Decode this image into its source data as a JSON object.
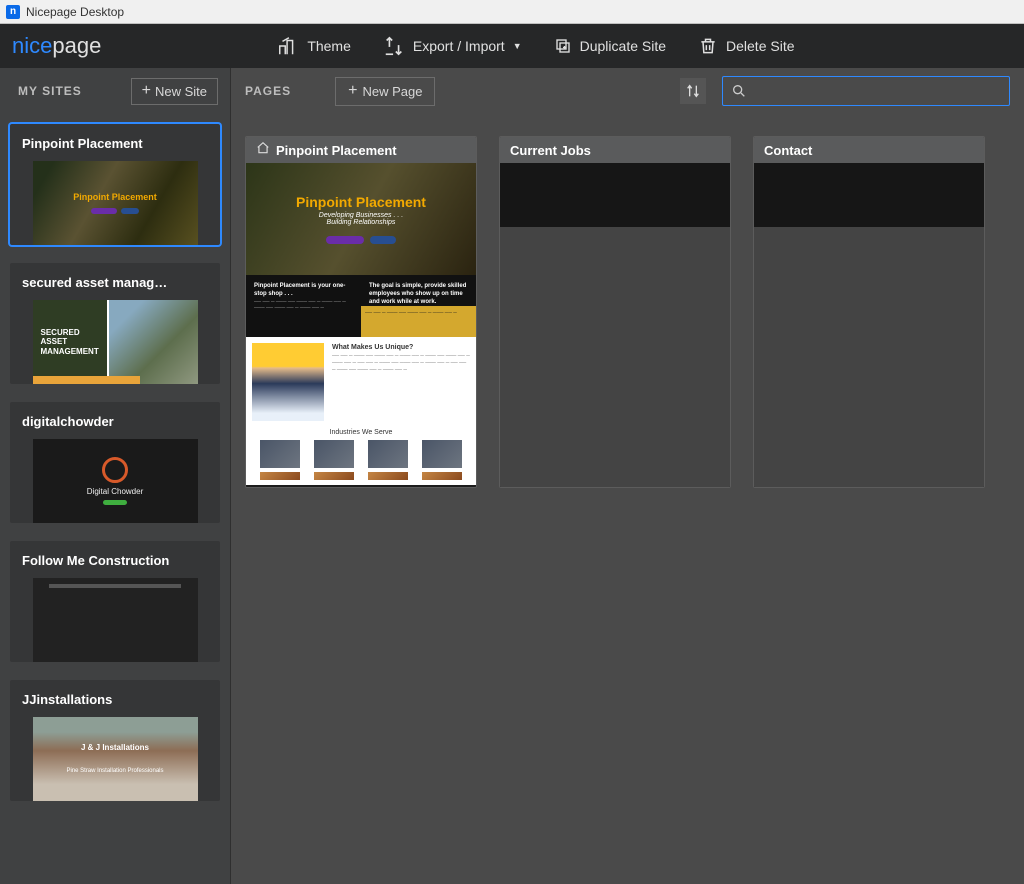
{
  "window": {
    "title": "Nicepage Desktop",
    "icon_letter": "n"
  },
  "logo": {
    "part1": "nice",
    "part2": "page"
  },
  "toolbar": {
    "theme_label": "Theme",
    "export_label": "Export / Import",
    "duplicate_label": "Duplicate Site",
    "delete_label": "Delete Site"
  },
  "sidebar": {
    "title": "MY SITES",
    "new_site_label": "New Site",
    "sites": [
      {
        "name": "Pinpoint Placement",
        "kind": "pinpoint",
        "active": true
      },
      {
        "name": "secured asset manag…",
        "kind": "sam",
        "active": false
      },
      {
        "name": "digitalchowder",
        "kind": "dc",
        "active": false
      },
      {
        "name": "Follow Me Construction",
        "kind": "fmc",
        "active": false
      },
      {
        "name": "JJinstallations",
        "kind": "jj",
        "active": false
      }
    ]
  },
  "thumbs": {
    "pinpoint_thumb_title": "Pinpoint Placement",
    "sam_lines": "SECURED\nASSET\nMANAGEMENT",
    "dc_title": "Digital Chowder",
    "jj_line1": "J & J Installations",
    "jj_line2": "Pine Straw Installation Professionals"
  },
  "content": {
    "pages_label": "PAGES",
    "new_page_label": "New Page",
    "search_placeholder": ""
  },
  "pages": [
    {
      "title": "Pinpoint Placement",
      "home": true,
      "kind": "pinpoint_full"
    },
    {
      "title": "Current Jobs",
      "home": false,
      "kind": "blank"
    },
    {
      "title": "Contact",
      "home": false,
      "kind": "blank"
    }
  ],
  "page_preview": {
    "hero_title": "Pinpoint Placement",
    "hero_sub1": "Developing Businesses . . .",
    "hero_sub2": "Building Relationships",
    "dark_left_title": "Pinpoint Placement is your one-stop shop . . .",
    "dark_right_title": "The goal is simple, provide skilled employees who show up on time and work while at work.",
    "white_h": "What Makes Us Unique?",
    "industries_title": "Industries We Serve"
  }
}
